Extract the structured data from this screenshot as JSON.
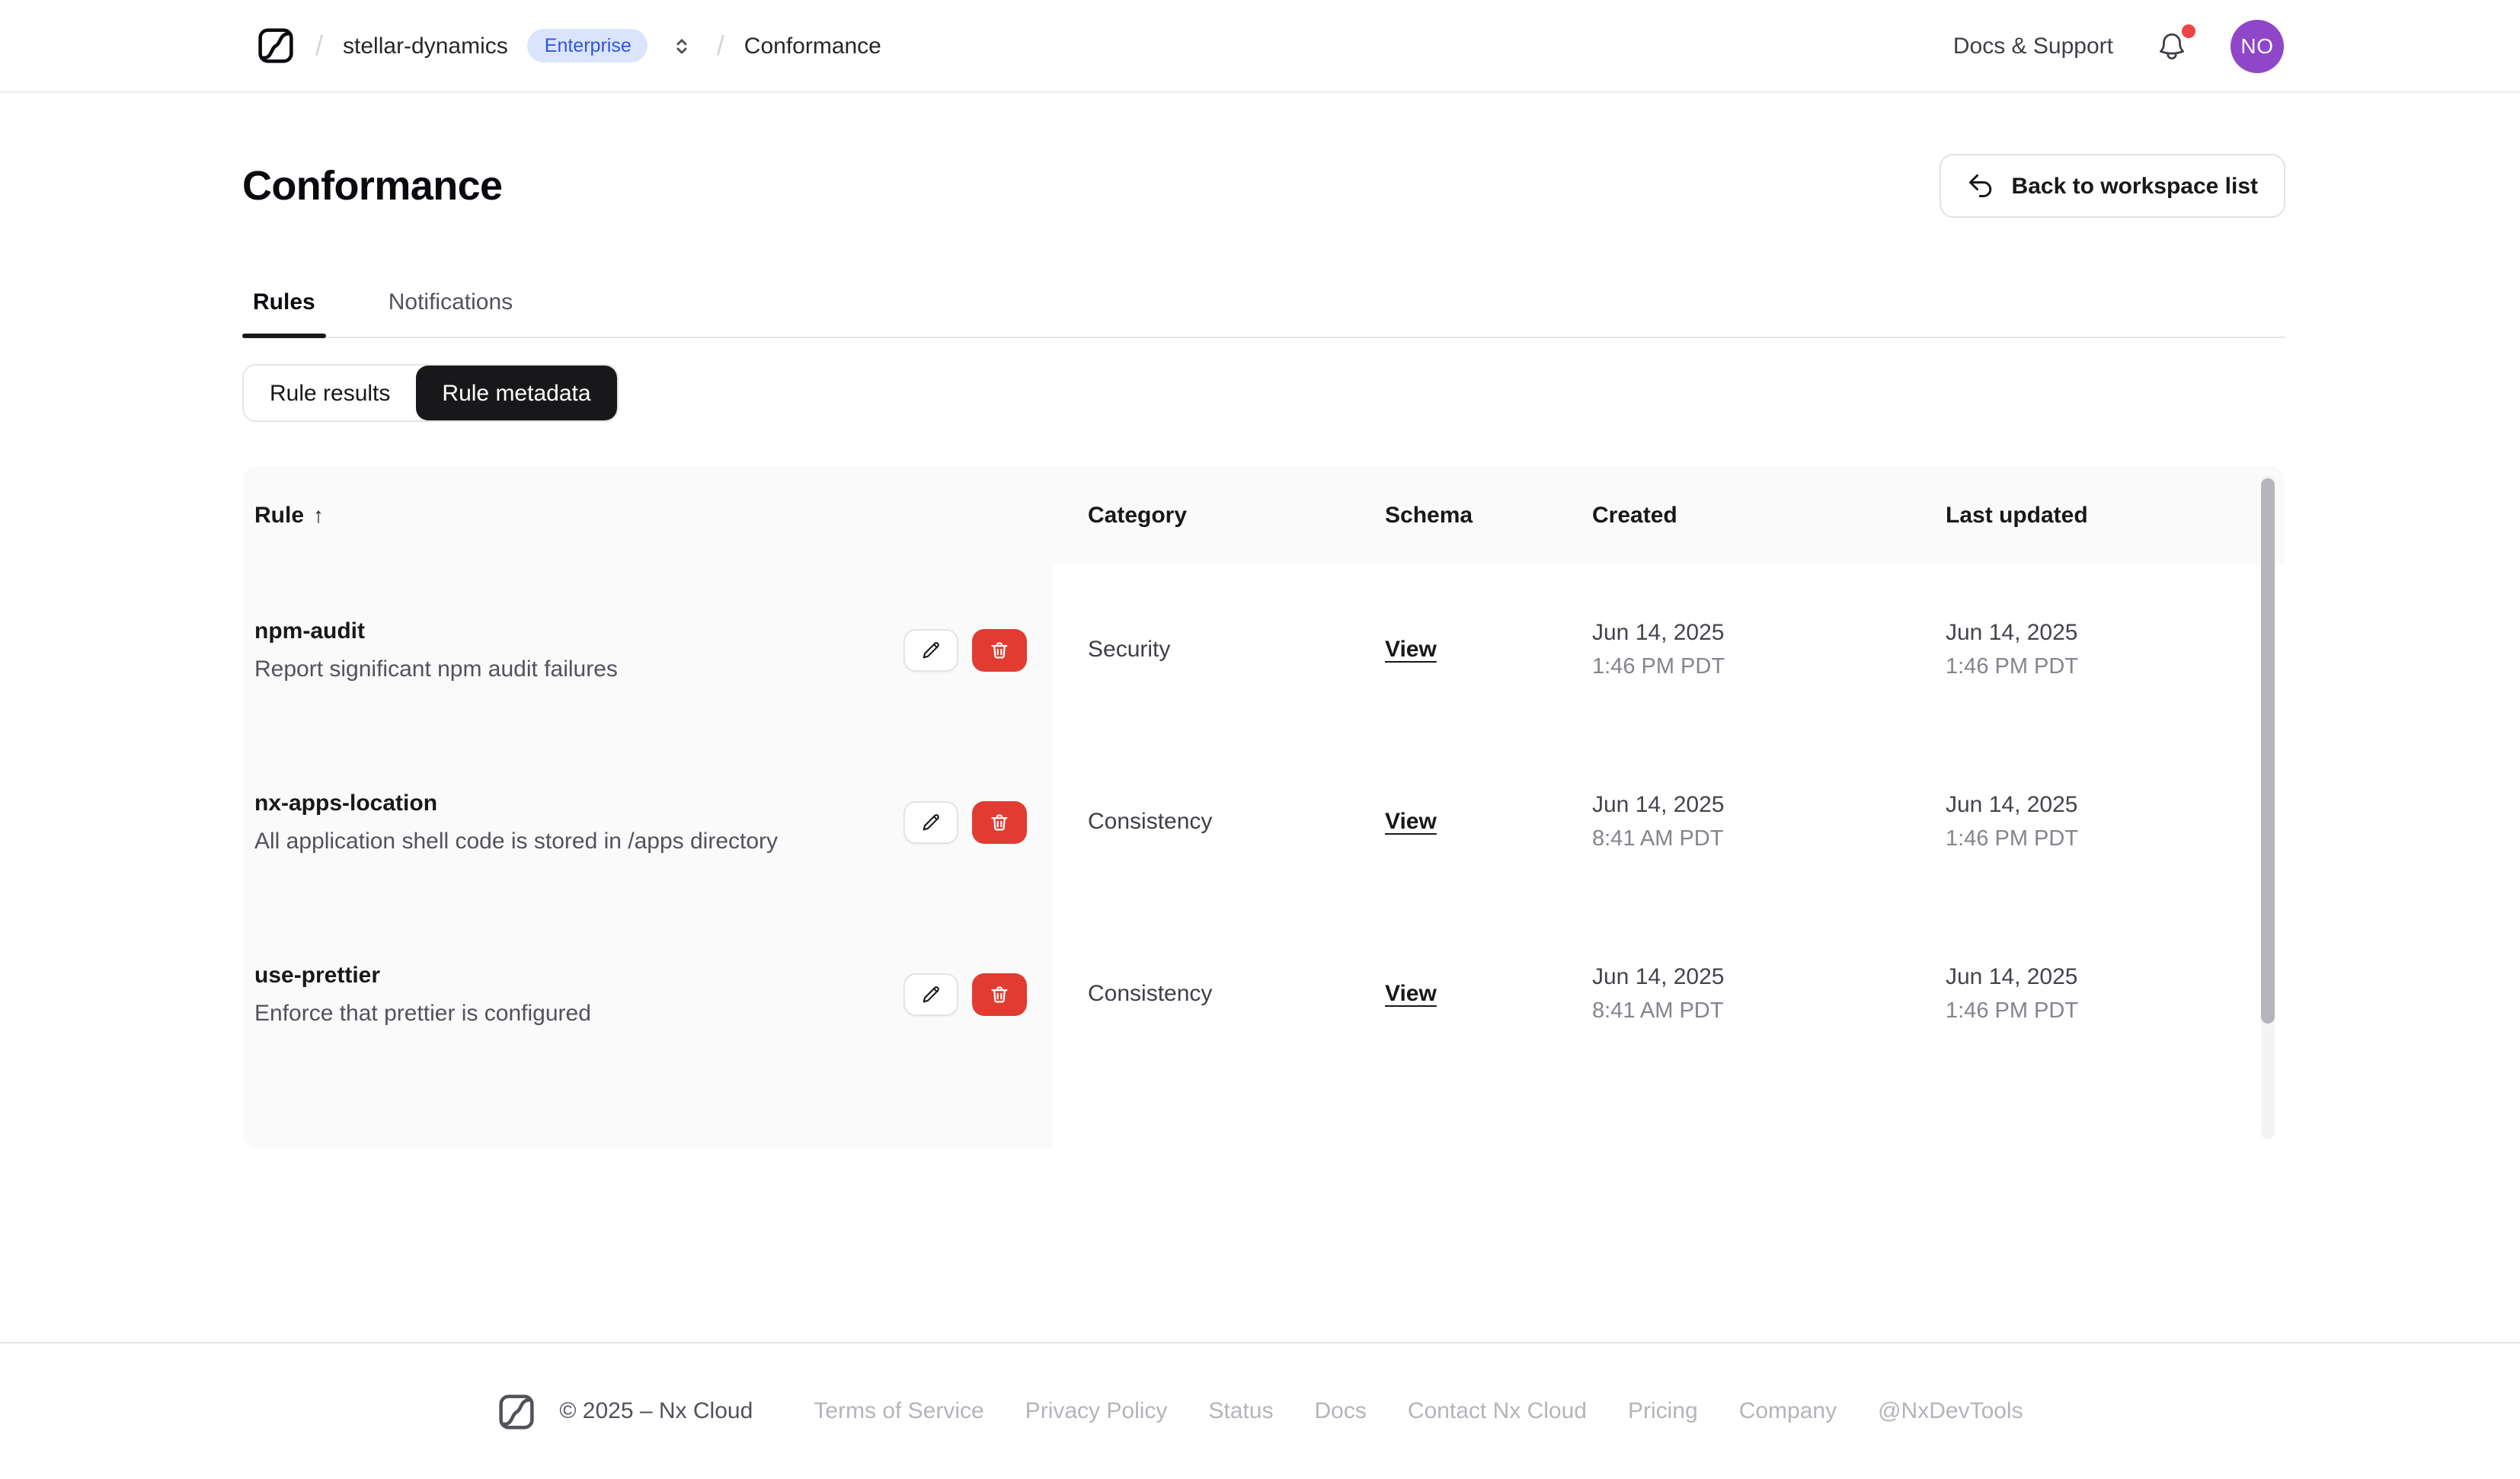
{
  "nav": {
    "breadcrumb": {
      "separator": "/",
      "workspace": "stellar-dynamics",
      "badge": "Enterprise",
      "page": "Conformance"
    },
    "docs_support": "Docs & Support",
    "avatar_initials": "NO"
  },
  "page": {
    "title": "Conformance",
    "back_button": "Back to workspace list"
  },
  "tabs": [
    {
      "label": "Rules",
      "active": true
    },
    {
      "label": "Notifications",
      "active": false
    }
  ],
  "segmented": [
    {
      "label": "Rule results",
      "active": false
    },
    {
      "label": "Rule metadata",
      "active": true
    }
  ],
  "table": {
    "columns": [
      "Rule",
      "Category",
      "Schema",
      "Created",
      "Last updated"
    ],
    "sort_indicator": "↑",
    "rows": [
      {
        "name": "npm-audit",
        "description": "Report significant npm audit failures",
        "category": "Security",
        "schema_link": "View",
        "created_date": "Jun 14, 2025",
        "created_time": "1:46 PM PDT",
        "updated_date": "Jun 14, 2025",
        "updated_time": "1:46 PM PDT"
      },
      {
        "name": "nx-apps-location",
        "description": "All application shell code is stored in /apps directory",
        "category": "Consistency",
        "schema_link": "View",
        "created_date": "Jun 14, 2025",
        "created_time": "8:41 AM PDT",
        "updated_date": "Jun 14, 2025",
        "updated_time": "1:46 PM PDT"
      },
      {
        "name": "use-prettier",
        "description": "Enforce that prettier is configured",
        "category": "Consistency",
        "schema_link": "View",
        "created_date": "Jun 14, 2025",
        "created_time": "8:41 AM PDT",
        "updated_date": "Jun 14, 2025",
        "updated_time": "1:46 PM PDT"
      }
    ]
  },
  "footer": {
    "copyright": "© 2025 – Nx Cloud",
    "links": [
      "Terms of Service",
      "Privacy Policy",
      "Status",
      "Docs",
      "Contact Nx Cloud",
      "Pricing",
      "Company",
      "@NxDevTools"
    ]
  },
  "colors": {
    "badge_bg": "#dbe4fd",
    "badge_text": "#2f55e1",
    "danger_button": "#e23c31",
    "avatar_bg": "#8f46c8",
    "notification_dot": "#ef4444",
    "active_segment_bg": "#18181b"
  }
}
